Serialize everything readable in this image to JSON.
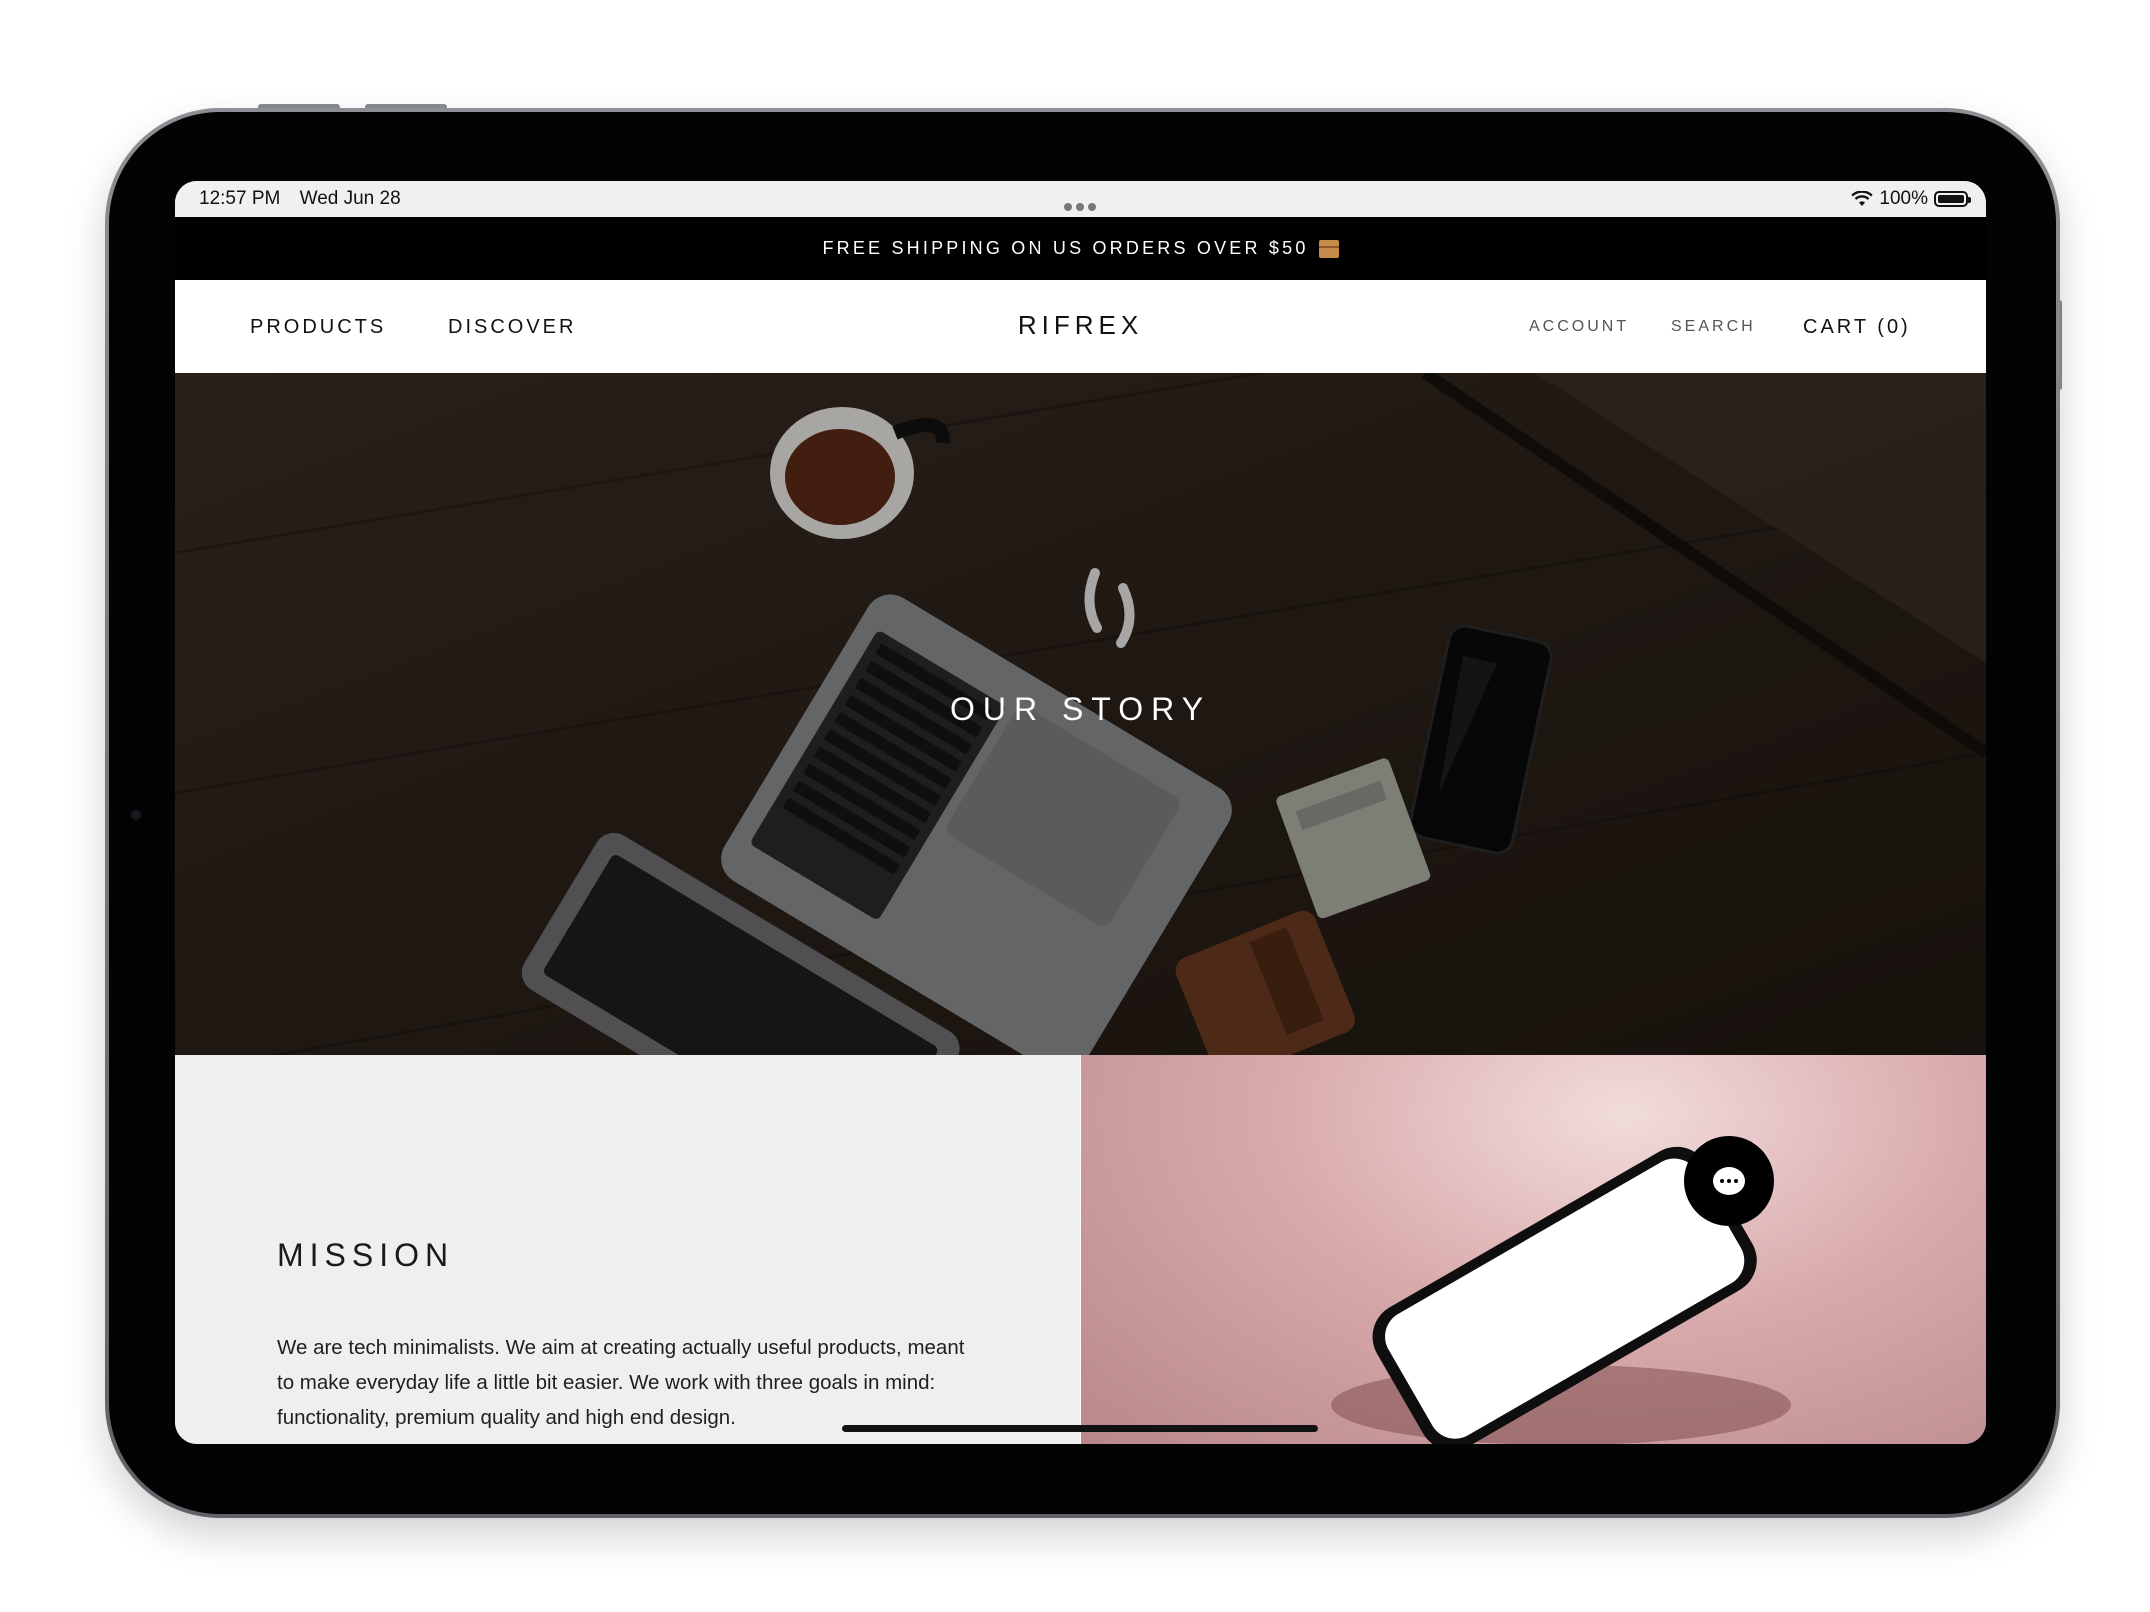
{
  "status_bar": {
    "time": "12:57 PM",
    "date": "Wed Jun 28",
    "battery": "100%",
    "wifi_icon": "wifi-icon",
    "battery_icon": "battery-icon"
  },
  "announcement": {
    "text": "FREE SHIPPING ON US ORDERS OVER $50",
    "icon": "package-icon"
  },
  "header": {
    "nav_left": [
      "PRODUCTS",
      "DISCOVER"
    ],
    "logo": "RIFREX",
    "account": "ACCOUNT",
    "search": "SEARCH",
    "cart": "CART (0)"
  },
  "hero": {
    "title": "OUR STORY"
  },
  "mission": {
    "heading": "MISSION",
    "body": "We are tech minimalists. We aim at creating actually useful products, meant to make everyday life a little bit easier. We work with three goals in mind: functionality, premium quality and high end design."
  },
  "chat": {
    "icon": "chat-icon"
  },
  "colors": {
    "announcement_bg": "#000000",
    "mission_bg": "#efefef",
    "phone_panel_bg": "#d9aaab"
  }
}
